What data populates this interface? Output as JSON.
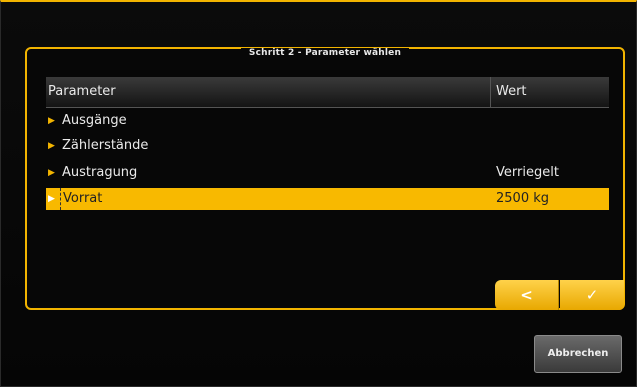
{
  "dialog": {
    "title": "Schritt 2 - Parameter wählen"
  },
  "table": {
    "columns": {
      "parameter": "Parameter",
      "value": "Wert"
    },
    "rows": [
      {
        "label": "Ausgänge",
        "value": ""
      },
      {
        "label": "Zählerstände",
        "value": ""
      },
      {
        "label": "Austragung",
        "value": "Verriegelt"
      },
      {
        "label": "Vorrat",
        "value": "2500 kg"
      }
    ],
    "selected_row_index": 3
  },
  "buttons": {
    "back_icon": "chevron-left-icon",
    "back_glyph": "<",
    "confirm_icon": "check-icon",
    "confirm_glyph": "✓",
    "cancel_label": "Abbrechen"
  },
  "colors": {
    "accent": "#f2b400",
    "selected_row": "#f8b900",
    "background": "#000000"
  }
}
